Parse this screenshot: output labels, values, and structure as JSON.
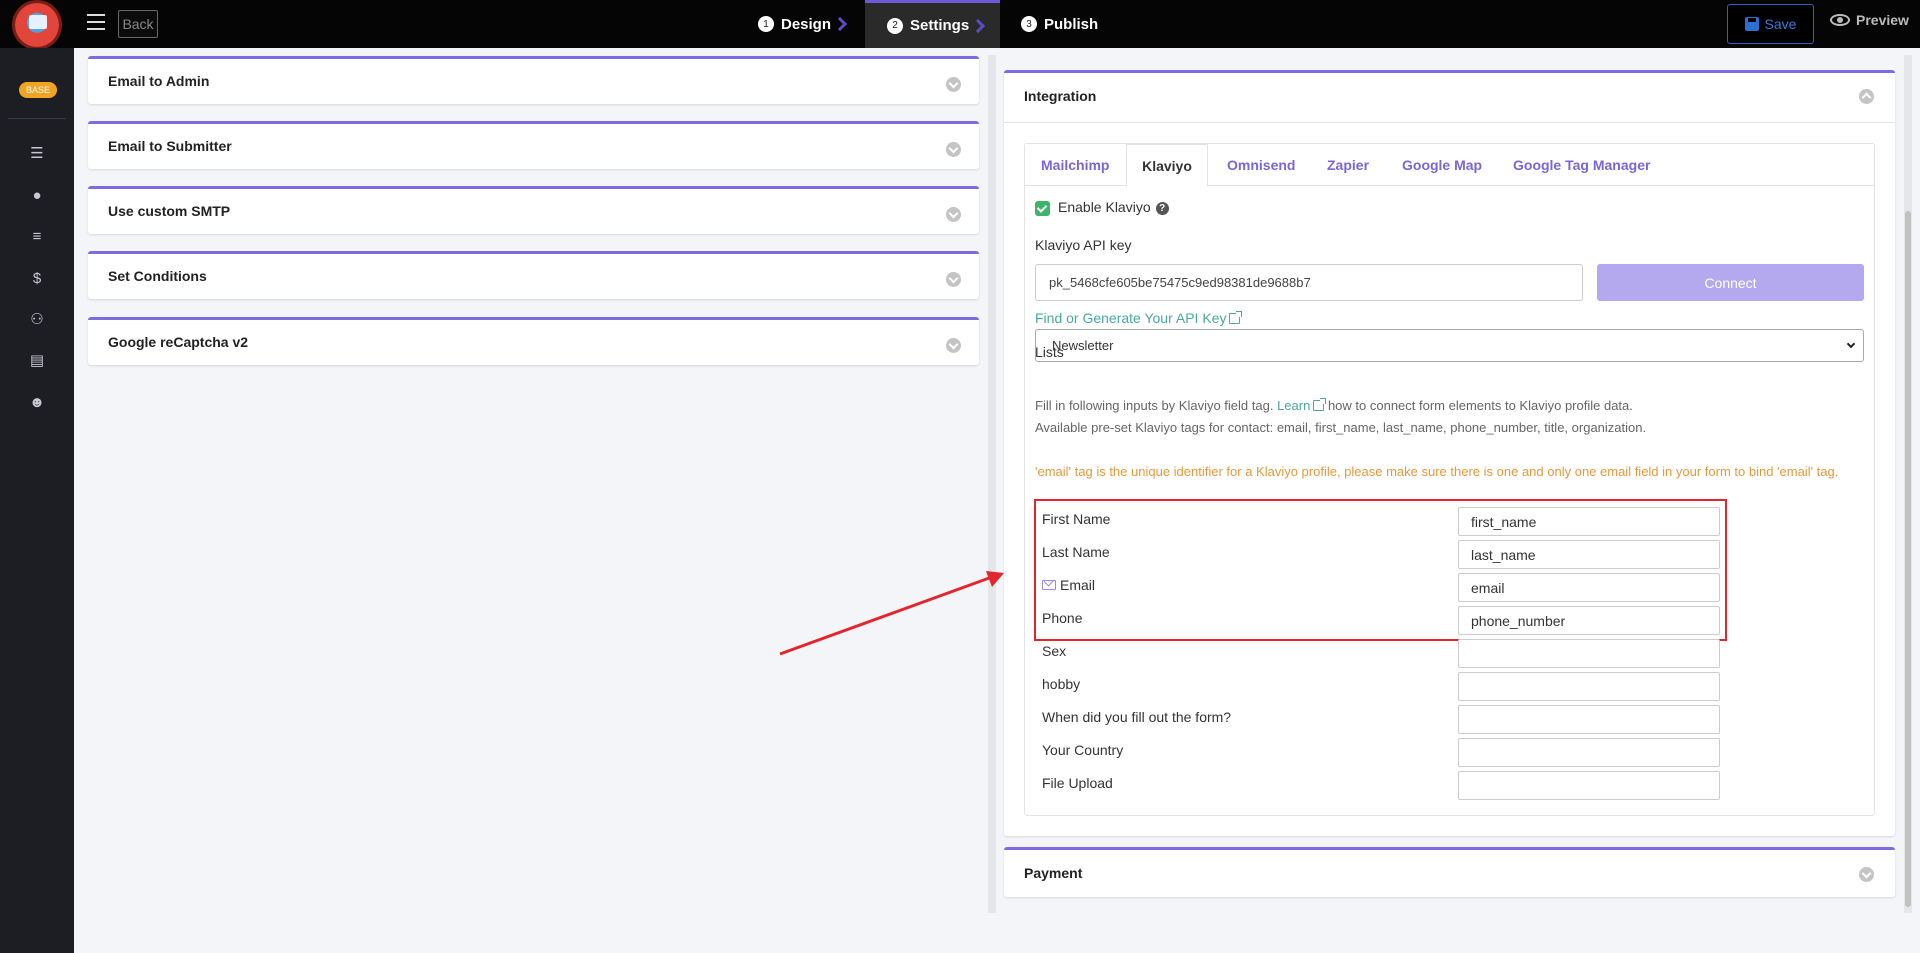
{
  "topbar": {
    "back_label": "Back",
    "steps": [
      {
        "num": "1",
        "label": "Design"
      },
      {
        "num": "2",
        "label": "Settings"
      },
      {
        "num": "3",
        "label": "Publish"
      }
    ],
    "save_label": "Save",
    "preview_label": "Preview"
  },
  "sidebar": {
    "badge": "BASE",
    "icons": [
      "list-icon",
      "user-icon",
      "menu-icon",
      "dollar-icon",
      "users-icon",
      "file-icon",
      "smile-icon"
    ]
  },
  "left_panels": [
    {
      "title": "Email to Admin"
    },
    {
      "title": "Email to Submitter"
    },
    {
      "title": "Use custom SMTP"
    },
    {
      "title": "Set Conditions"
    },
    {
      "title": "Google reCaptcha v2"
    }
  ],
  "integration": {
    "title": "Integration",
    "tabs": [
      "Mailchimp",
      "Klaviyo",
      "Omnisend",
      "Zapier",
      "Google Map",
      "Google Tag Manager"
    ],
    "active_tab": "Klaviyo",
    "enable_label": "Enable Klaviyo",
    "enable_checked": true,
    "api_key_label": "Klaviyo API key",
    "api_key_value": "pk_5468cfe605be75475c9ed98381de9688b7",
    "connect_label": "Connect",
    "find_key_link": "Find or Generate Your API Key",
    "lists_label": "Lists",
    "lists_selected": "Newsletter",
    "info_line1_pre": "Fill in following inputs by Klaviyo field tag.",
    "info_line1_link": "Learn",
    "info_line1_post": "how to connect form elements to Klaviyo profile data.",
    "info_line2": "Available pre-set Klaviyo tags for contact: email, first_name, last_name, phone_number, title, organization.",
    "warning": "'email' tag is the unique identifier for a Klaviyo profile, please make sure there is one and only one email field in your form to bind 'email' tag.",
    "fields": [
      {
        "label": "First Name",
        "value": "first_name"
      },
      {
        "label": "Last Name",
        "value": "last_name"
      },
      {
        "label": "Email",
        "value": "email"
      },
      {
        "label": "Phone",
        "value": "phone_number"
      },
      {
        "label": "Sex",
        "value": ""
      },
      {
        "label": "hobby",
        "value": ""
      },
      {
        "label": "When did you fill out the form?",
        "value": ""
      },
      {
        "label": "Your Country",
        "value": ""
      },
      {
        "label": "File Upload",
        "value": ""
      }
    ]
  },
  "payment": {
    "title": "Payment"
  },
  "colors": {
    "accent": "#7f6be0",
    "highlight": "#e3262d",
    "link": "#49a9a0",
    "warning": "#e8983a"
  }
}
